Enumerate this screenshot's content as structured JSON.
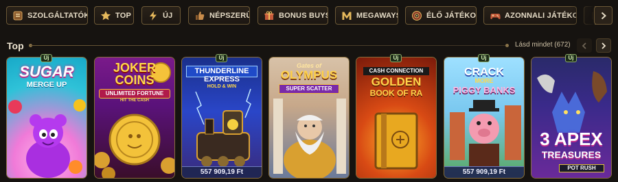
{
  "nav": {
    "items": [
      {
        "label": "SZOLGÁLTATÓK",
        "icon": "provider-book-icon"
      },
      {
        "label": "TOP",
        "icon": "star-icon"
      },
      {
        "label": "ÚJ",
        "icon": "lightning-icon"
      },
      {
        "label": "NÉPSZERŰ",
        "icon": "popular-hand-icon"
      },
      {
        "label": "BONUS BUYS",
        "icon": "gift-icon"
      },
      {
        "label": "MEGAWAYS",
        "icon": "megaways-m-icon"
      },
      {
        "label": "ÉLŐ JÁTÉKOK",
        "icon": "roulette-icon"
      },
      {
        "label": "AZONNALI JÁTÉKOK",
        "icon": "gamepad-icon"
      }
    ]
  },
  "section": {
    "title": "Top",
    "see_all": "Lásd mindet (672)"
  },
  "badge_new": "Új",
  "games": [
    {
      "line1": "SUGAR",
      "line2": "MERGE UP",
      "new": true
    },
    {
      "line1": "JOKER",
      "line2": "COINS",
      "line3": "UNLIMITED FORTUNE",
      "line4": "HIT THE CASH",
      "new": false
    },
    {
      "line1": "THUNDERLINE",
      "line2": "EXPRESS",
      "line3": "HOLD & WIN",
      "price": "557 909,19 Ft",
      "new": true
    },
    {
      "line1": "Gates of",
      "line2": "OLYMPUS",
      "line3": "SUPER SCATTER",
      "new": false
    },
    {
      "line1": "CASH CONNECTION",
      "line2": "GOLDEN",
      "line3": "BOOK OF RA",
      "new": true
    },
    {
      "line1": "CRACK",
      "line2": "MORE",
      "line3": "PIGGY BANKS",
      "price": "557 909,19 Ft",
      "new": true
    },
    {
      "line1": "3 APEX",
      "line2": "TREASURES",
      "line3": "POT RUSH",
      "new": true
    }
  ],
  "colors": {
    "background": "#161310",
    "gold_border": "#6b5836",
    "new_badge": "#8fb06a"
  }
}
